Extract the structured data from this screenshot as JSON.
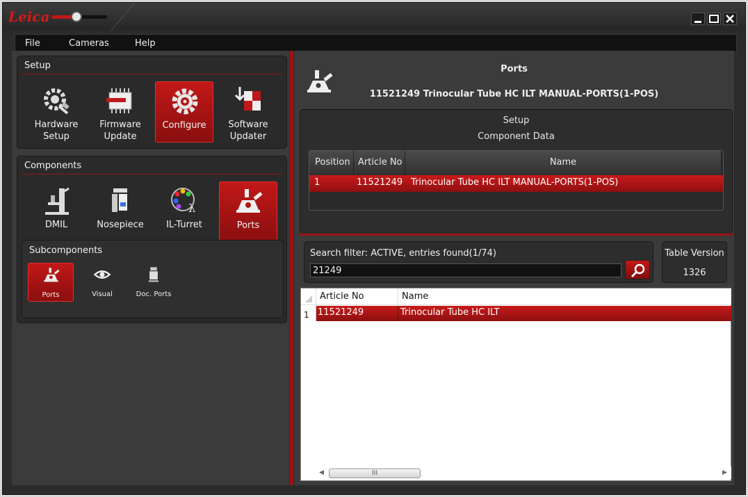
{
  "app": {
    "logo_text": "Leica",
    "window_buttons": [
      "minimize",
      "maximize",
      "close"
    ]
  },
  "menu": [
    "File",
    "Cameras",
    "Help"
  ],
  "setup_group": {
    "title": "Setup",
    "items": [
      {
        "label": "Hardware\nSetup",
        "icon": "gear-plug-icon",
        "active": false
      },
      {
        "label": "Firmware\nUpdate",
        "icon": "chip-icon",
        "active": false
      },
      {
        "label": "Configure",
        "icon": "gear-icon",
        "active": true
      },
      {
        "label": "Software\nUpdater",
        "icon": "software-update-icon",
        "active": false
      }
    ]
  },
  "components_group": {
    "title": "Components",
    "items": [
      {
        "label": "DMIL",
        "icon": "microscope-icon",
        "active": false
      },
      {
        "label": "Nosepiece",
        "icon": "nosepiece-icon",
        "active": false
      },
      {
        "label": "IL-Turret",
        "icon": "il-turret-icon",
        "active": false
      },
      {
        "label": "Ports",
        "icon": "ports-icon",
        "active": true
      }
    ]
  },
  "subcomponents_group": {
    "title": "Subcomponents",
    "items": [
      {
        "label": "Ports",
        "icon": "ports-icon",
        "active": true
      },
      {
        "label": "Visual",
        "icon": "eye-icon",
        "active": false
      },
      {
        "label": "Doc. Ports",
        "icon": "camera-port-icon",
        "active": false
      }
    ]
  },
  "detail": {
    "title": "Ports",
    "subtitle": "11521249 Trinocular Tube HC ILT MANUAL-PORTS(1-POS)",
    "setup_label": "Setup",
    "component_data_label": "Component Data",
    "table": {
      "columns": [
        "Position",
        "Article No",
        "Name"
      ],
      "rows": [
        [
          "1",
          "11521249",
          "Trinocular Tube HC ILT MANUAL-PORTS(1-POS)"
        ]
      ]
    }
  },
  "search": {
    "label": "Search filter: ACTIVE, entries found(1/74)",
    "value": "21249",
    "table_version_label": "Table Version",
    "table_version_value": "1326"
  },
  "results": {
    "columns": [
      "Article No",
      "Name"
    ],
    "rows": [
      {
        "num": "1",
        "article": "11521249",
        "name": "Trinocular Tube HC ILT"
      }
    ],
    "scroll_grip": "III"
  },
  "colors": {
    "accent_red": "#c01818",
    "panel_dark": "#2a2a2a",
    "background": "#3b3b3b"
  }
}
